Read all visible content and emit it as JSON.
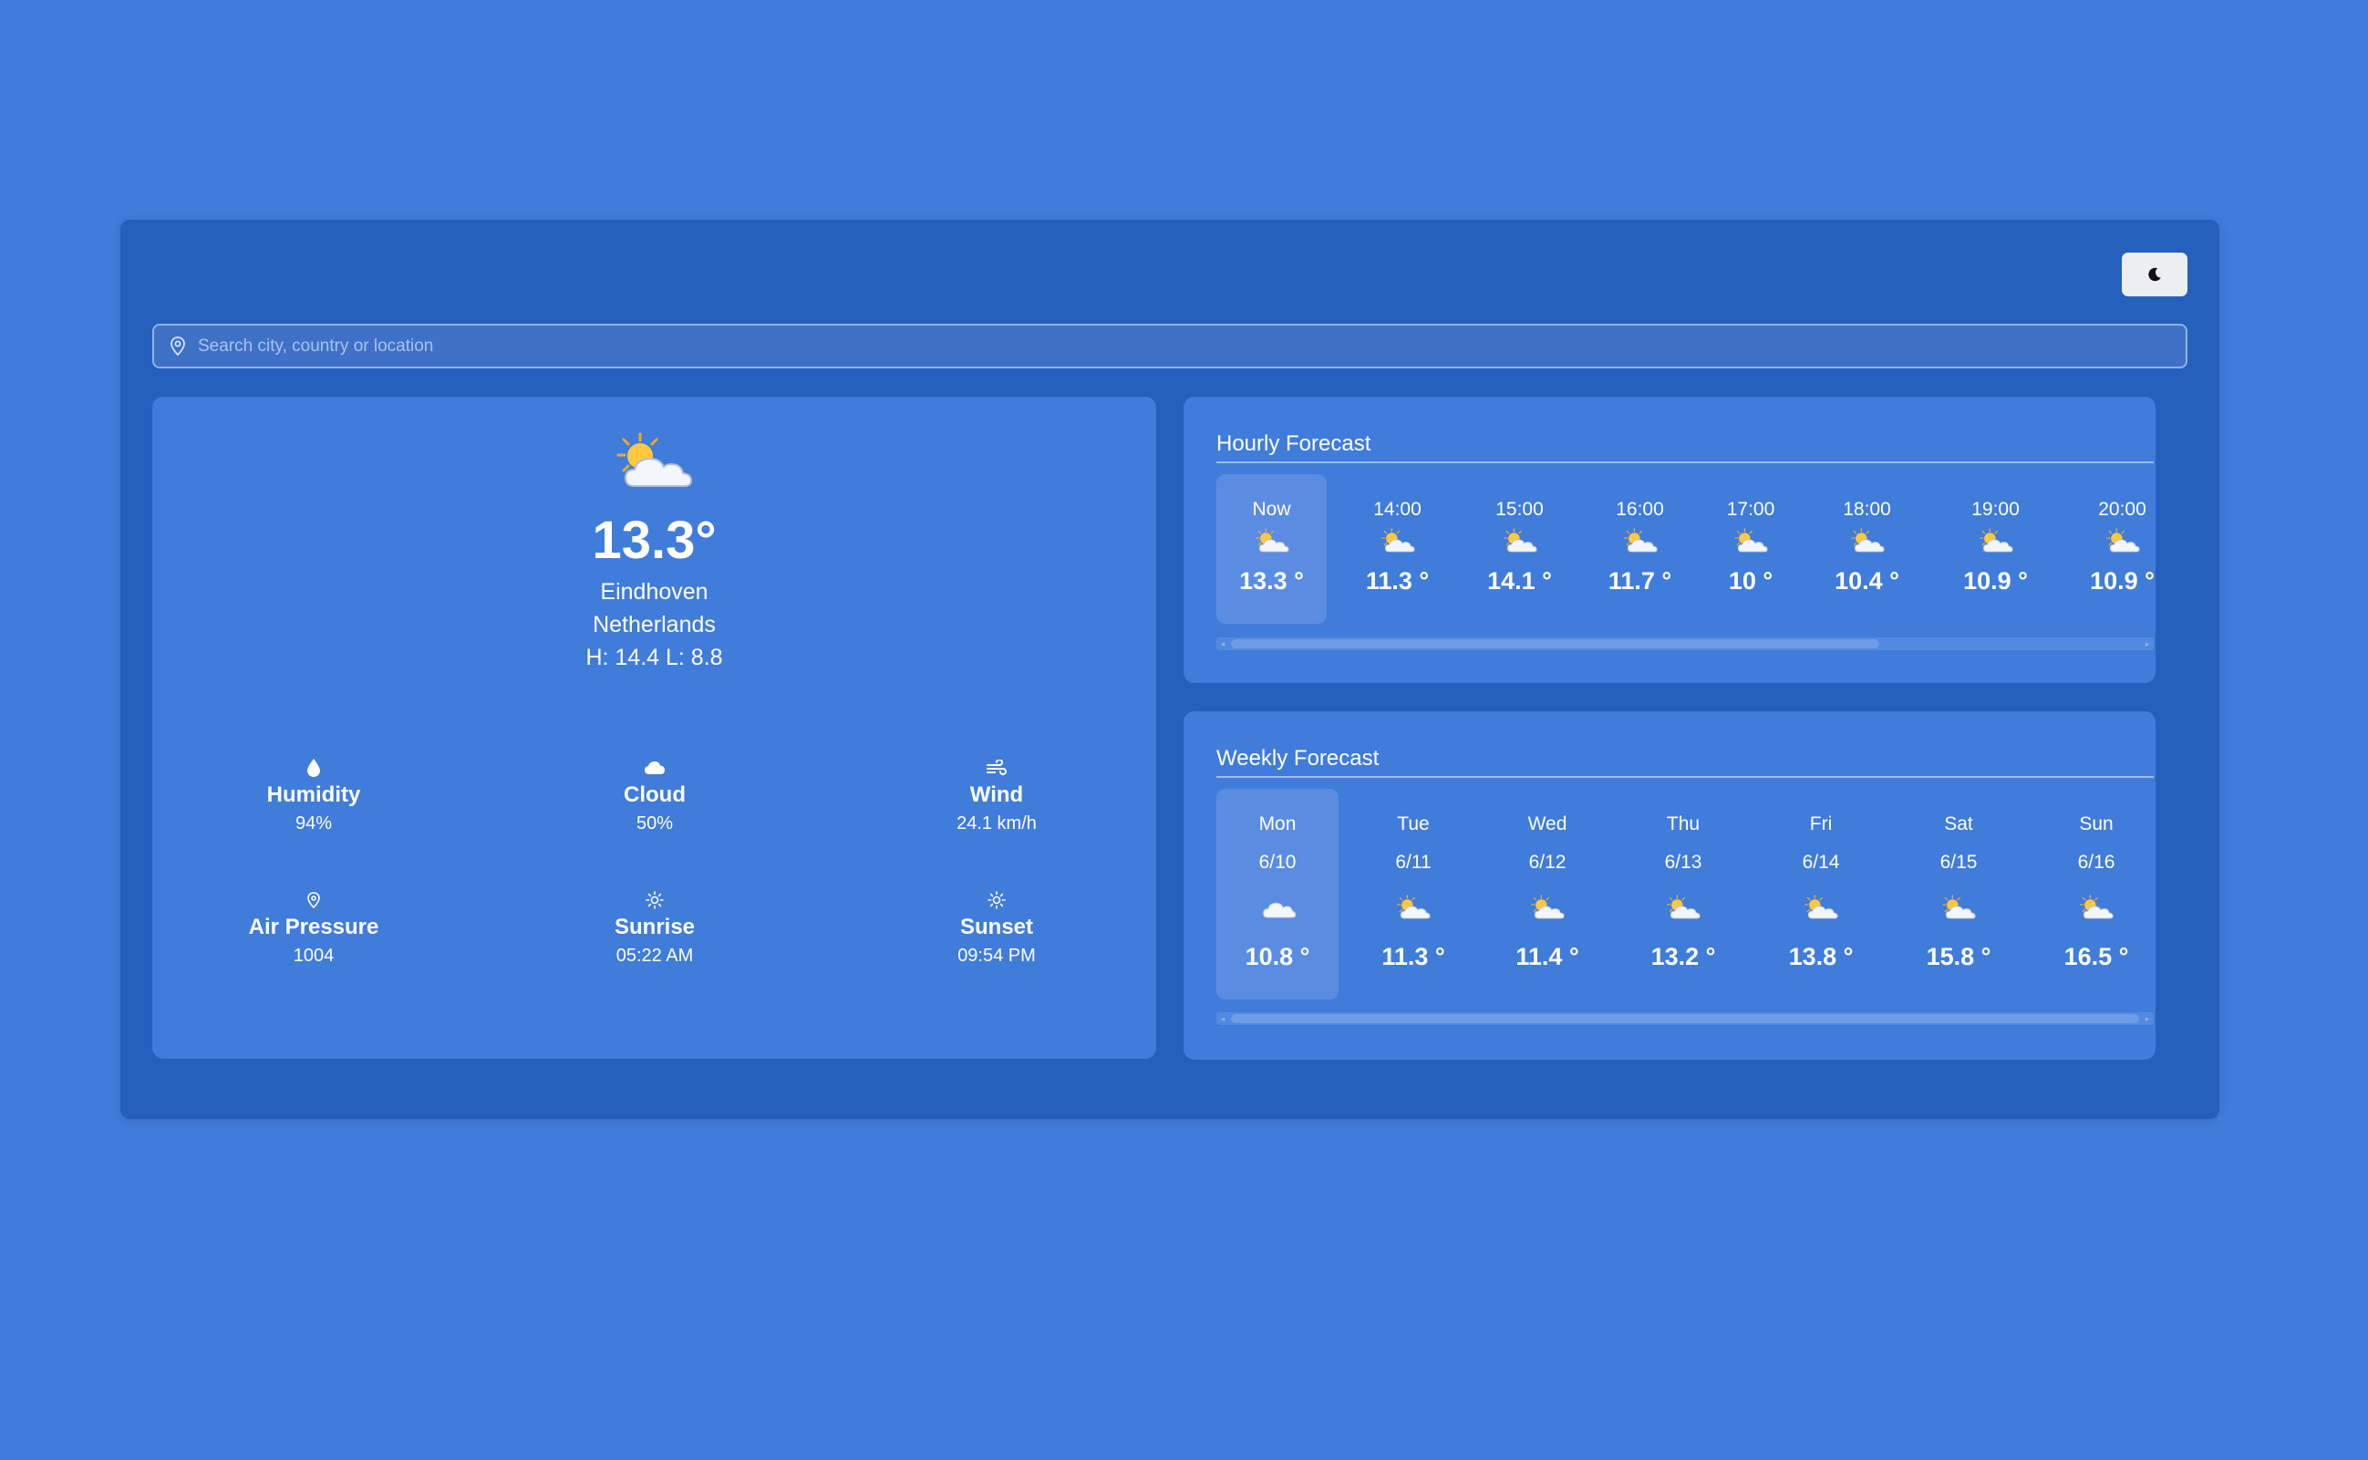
{
  "colors": {
    "page_background": "#407cda",
    "app_background": "#2560bd",
    "panel_background": "#407cda",
    "active_item": "#5a8de2"
  },
  "theme_toggle": {
    "icon": "moon-icon"
  },
  "search": {
    "placeholder": "Search city, country or location",
    "icon": "location-pin-icon"
  },
  "current": {
    "icon": "partly-cloudy-icon",
    "temperature": "13.3°",
    "city": "Eindhoven",
    "country": "Netherlands",
    "high_low": "H: 14.4 L: 8.8",
    "stats": [
      {
        "icon": "droplet-icon",
        "label": "Humidity",
        "value": "94%"
      },
      {
        "icon": "cloud-icon",
        "label": "Cloud",
        "value": "50%"
      },
      {
        "icon": "wind-icon",
        "label": "Wind",
        "value": "24.1 km/h"
      },
      {
        "icon": "pressure-pin-icon",
        "label": "Air Pressure",
        "value": "1004"
      },
      {
        "icon": "sunrise-icon",
        "label": "Sunrise",
        "value": "05:22 AM"
      },
      {
        "icon": "sunset-icon",
        "label": "Sunset",
        "value": "09:54 PM"
      }
    ]
  },
  "hourly": {
    "title": "Hourly Forecast",
    "items": [
      {
        "time": "Now",
        "temp": "13.3 °",
        "icon": "partly-cloudy-icon"
      },
      {
        "time": "14:00",
        "temp": "11.3 °",
        "icon": "partly-cloudy-icon"
      },
      {
        "time": "15:00",
        "temp": "14.1 °",
        "icon": "partly-cloudy-icon"
      },
      {
        "time": "16:00",
        "temp": "11.7 °",
        "icon": "partly-cloudy-icon"
      },
      {
        "time": "17:00",
        "temp": "10 °",
        "icon": "partly-cloudy-icon"
      },
      {
        "time": "18:00",
        "temp": "10.4 °",
        "icon": "partly-cloudy-icon"
      },
      {
        "time": "19:00",
        "temp": "10.9 °",
        "icon": "partly-cloudy-icon"
      },
      {
        "time": "20:00",
        "temp": "10.9 °",
        "icon": "partly-cloudy-icon"
      }
    ]
  },
  "weekly": {
    "title": "Weekly Forecast",
    "items": [
      {
        "day": "Mon",
        "date": "6/10",
        "temp": "10.8 °",
        "icon": "cloud-icon"
      },
      {
        "day": "Tue",
        "date": "6/11",
        "temp": "11.3 °",
        "icon": "partly-cloudy-icon"
      },
      {
        "day": "Wed",
        "date": "6/12",
        "temp": "11.4 °",
        "icon": "partly-cloudy-icon"
      },
      {
        "day": "Thu",
        "date": "6/13",
        "temp": "13.2 °",
        "icon": "partly-cloudy-icon"
      },
      {
        "day": "Fri",
        "date": "6/14",
        "temp": "13.8 °",
        "icon": "partly-cloudy-icon"
      },
      {
        "day": "Sat",
        "date": "6/15",
        "temp": "15.8 °",
        "icon": "partly-cloudy-icon"
      },
      {
        "day": "Sun",
        "date": "6/16",
        "temp": "16.5 °",
        "icon": "partly-cloudy-icon"
      }
    ]
  }
}
